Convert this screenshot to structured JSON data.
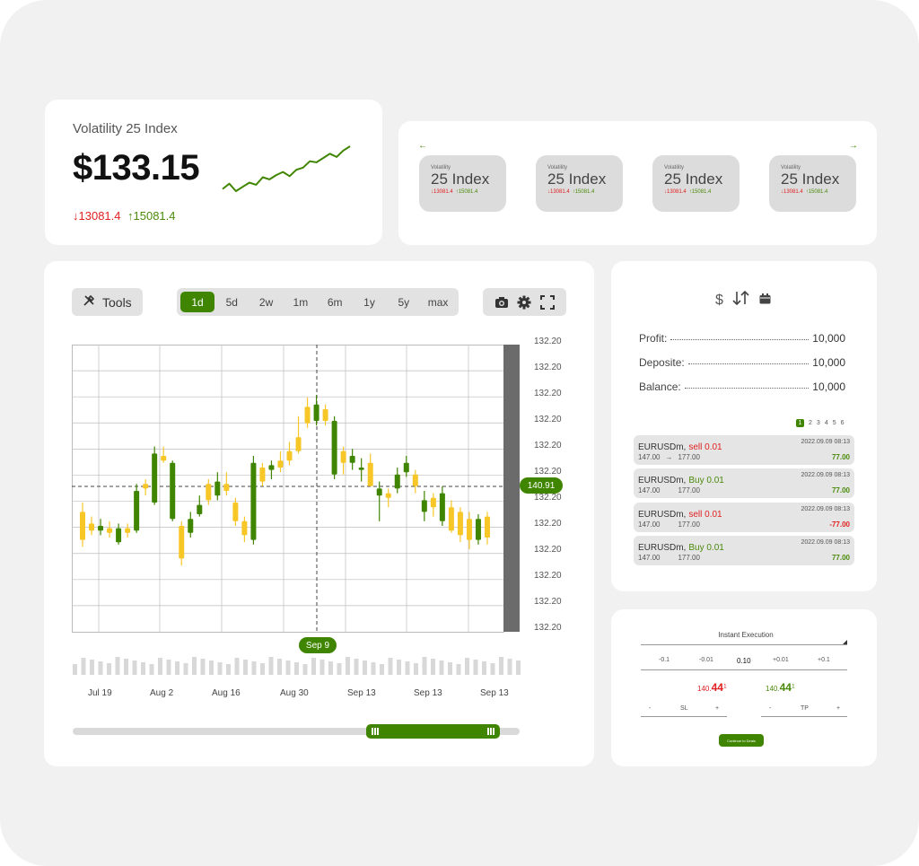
{
  "ticker": {
    "title": "Volatility 25 Index",
    "price": "$133.15",
    "change_down": "13081.4",
    "change_up": "15081.4",
    "sparkline": [
      3,
      3.5,
      2.8,
      3.2,
      3.6,
      3.4,
      4.1,
      3.9,
      4.3,
      4.6,
      4.2,
      4.8,
      5.0,
      5.6,
      5.5,
      5.9,
      6.3,
      6.0,
      6.6,
      7.0
    ]
  },
  "indices": {
    "prev_icon": "arrow-left-icon",
    "next_icon": "arrow-right-icon",
    "cards": [
      {
        "label": "Volatility",
        "name": "25 Index",
        "down": "13081.4",
        "up": "15081.4"
      },
      {
        "label": "Volatility",
        "name": "25 Index",
        "down": "13081.4",
        "up": "15081.4"
      },
      {
        "label": "Volatility",
        "name": "25 Index",
        "down": "13081.4",
        "up": "15081.4"
      },
      {
        "label": "Volatility",
        "name": "25 Index",
        "down": "13081.4",
        "up": "15081.4"
      }
    ]
  },
  "chart": {
    "tools_label": "Tools",
    "ranges": [
      "1d",
      "5d",
      "2w",
      "1m",
      "6m",
      "1y",
      "5y",
      "max"
    ],
    "active_range": "1d",
    "icons": [
      "camera-icon",
      "gear-icon",
      "fullscreen-icon"
    ],
    "current_price_tag": "140.91",
    "crosshair_date": "Sep 9",
    "colors": {
      "up": "#3f8500",
      "down": "#f7c627"
    }
  },
  "chart_data": {
    "type": "candlestick",
    "y_tick_labels": [
      "132.20",
      "132.20",
      "132.20",
      "132.20",
      "132.20",
      "132.20",
      "132.20",
      "132.20",
      "132.20",
      "132.20",
      "132.20",
      "132.20"
    ],
    "x_tick_labels": [
      "Jul 19",
      "Aug 2",
      "Aug 16",
      "Aug 30",
      "Sep 13",
      "Sep 13",
      "Sep 13"
    ],
    "candles": [
      {
        "dir": "down",
        "o": 4.6,
        "c": 3.4,
        "h": 5.0,
        "l": 3.1
      },
      {
        "dir": "down",
        "o": 4.1,
        "c": 3.8,
        "h": 4.4,
        "l": 3.6
      },
      {
        "dir": "up",
        "o": 3.8,
        "c": 4.0,
        "h": 4.3,
        "l": 3.6
      },
      {
        "dir": "down",
        "o": 3.9,
        "c": 3.7,
        "h": 4.2,
        "l": 3.5
      },
      {
        "dir": "up",
        "o": 3.3,
        "c": 3.9,
        "h": 4.1,
        "l": 3.2
      },
      {
        "dir": "down",
        "o": 3.9,
        "c": 3.7,
        "h": 4.1,
        "l": 3.5
      },
      {
        "dir": "up",
        "o": 3.8,
        "c": 5.5,
        "h": 5.8,
        "l": 3.7
      },
      {
        "dir": "down",
        "o": 5.8,
        "c": 5.6,
        "h": 6.0,
        "l": 5.3
      },
      {
        "dir": "up",
        "o": 5.0,
        "c": 7.1,
        "h": 7.4,
        "l": 4.9
      },
      {
        "dir": "down",
        "o": 7.0,
        "c": 6.8,
        "h": 7.4,
        "l": 6.7
      },
      {
        "dir": "up",
        "o": 4.3,
        "c": 6.7,
        "h": 6.8,
        "l": 4.2
      },
      {
        "dir": "down",
        "o": 4.0,
        "c": 2.6,
        "h": 4.2,
        "l": 2.3
      },
      {
        "dir": "up",
        "o": 3.7,
        "c": 4.3,
        "h": 4.6,
        "l": 3.5
      },
      {
        "dir": "up",
        "o": 4.5,
        "c": 4.9,
        "h": 5.3,
        "l": 4.4
      },
      {
        "dir": "down",
        "o": 5.8,
        "c": 5.1,
        "h": 6.0,
        "l": 4.9
      },
      {
        "dir": "up",
        "o": 5.3,
        "c": 5.9,
        "h": 6.3,
        "l": 5.1
      },
      {
        "dir": "down",
        "o": 5.8,
        "c": 5.5,
        "h": 6.3,
        "l": 5.3
      },
      {
        "dir": "down",
        "o": 5.0,
        "c": 4.2,
        "h": 5.2,
        "l": 4.0
      },
      {
        "dir": "down",
        "o": 4.2,
        "c": 3.6,
        "h": 4.4,
        "l": 3.3
      },
      {
        "dir": "up",
        "o": 3.4,
        "c": 6.7,
        "h": 7.0,
        "l": 3.2
      },
      {
        "dir": "down",
        "o": 6.5,
        "c": 5.9,
        "h": 6.7,
        "l": 5.7
      },
      {
        "dir": "up",
        "o": 6.4,
        "c": 6.6,
        "h": 6.8,
        "l": 6.0
      },
      {
        "dir": "down",
        "o": 6.8,
        "c": 6.5,
        "h": 7.2,
        "l": 6.3
      },
      {
        "dir": "down",
        "o": 7.2,
        "c": 6.8,
        "h": 7.6,
        "l": 6.6
      },
      {
        "dir": "down",
        "o": 7.8,
        "c": 7.2,
        "h": 8.7,
        "l": 7.1
      },
      {
        "dir": "down",
        "o": 9.1,
        "c": 8.4,
        "h": 9.5,
        "l": 8.2
      },
      {
        "dir": "up",
        "o": 8.5,
        "c": 9.2,
        "h": 9.6,
        "l": 8.3
      },
      {
        "dir": "down",
        "o": 9.0,
        "c": 8.5,
        "h": 9.2,
        "l": 8.3
      },
      {
        "dir": "up",
        "o": 6.2,
        "c": 8.5,
        "h": 8.7,
        "l": 6.0
      },
      {
        "dir": "down",
        "o": 7.2,
        "c": 6.7,
        "h": 7.4,
        "l": 6.2
      },
      {
        "dir": "up",
        "o": 6.7,
        "c": 7.0,
        "h": 7.3,
        "l": 6.4
      },
      {
        "dir": "up",
        "o": 6.4,
        "c": 6.5,
        "h": 6.9,
        "l": 5.9
      },
      {
        "dir": "down",
        "o": 6.7,
        "c": 5.7,
        "h": 7.1,
        "l": 5.7
      },
      {
        "dir": "up",
        "o": 5.3,
        "c": 5.6,
        "h": 5.9,
        "l": 4.2
      },
      {
        "dir": "down",
        "o": 5.4,
        "c": 5.2,
        "h": 5.6,
        "l": 4.8
      },
      {
        "dir": "up",
        "o": 5.6,
        "c": 6.2,
        "h": 6.5,
        "l": 5.4
      },
      {
        "dir": "up",
        "o": 6.3,
        "c": 6.7,
        "h": 7.0,
        "l": 6.1
      },
      {
        "dir": "down",
        "o": 6.2,
        "c": 5.7,
        "h": 6.4,
        "l": 5.4
      },
      {
        "dir": "up",
        "o": 4.6,
        "c": 5.1,
        "h": 5.5,
        "l": 4.2
      },
      {
        "dir": "down",
        "o": 5.2,
        "c": 4.8,
        "h": 5.4,
        "l": 4.4
      },
      {
        "dir": "up",
        "o": 4.2,
        "c": 5.4,
        "h": 5.7,
        "l": 4.0
      },
      {
        "dir": "down",
        "o": 4.8,
        "c": 3.8,
        "h": 5.1,
        "l": 3.7
      },
      {
        "dir": "down",
        "o": 4.6,
        "c": 3.6,
        "h": 4.8,
        "l": 3.3
      },
      {
        "dir": "down",
        "o": 4.3,
        "c": 3.4,
        "h": 4.6,
        "l": 3.0
      },
      {
        "dir": "up",
        "o": 3.4,
        "c": 4.3,
        "h": 4.5,
        "l": 3.2
      },
      {
        "dir": "down",
        "o": 4.4,
        "c": 3.5,
        "h": 4.6,
        "l": 3.2
      }
    ]
  },
  "account": {
    "icons": [
      "dollar-icon",
      "sort-arrows-icon",
      "calendar-icon"
    ],
    "rows": [
      {
        "key": "Profit:",
        "value": "10,000"
      },
      {
        "key": "Deposite:",
        "value": "10,000"
      },
      {
        "key": "Balance:",
        "value": "10,000"
      }
    ],
    "pages": [
      "1",
      "2",
      "3",
      "4",
      "5",
      "6"
    ],
    "trades": [
      {
        "symbol": "EURUSDm,",
        "side": "sell 0.01",
        "side_type": "sell",
        "date": "2022.09.09 08:13",
        "open": "147.00",
        "arrow": "→",
        "close": "177.00",
        "pl": "77.00",
        "pl_type": "pos"
      },
      {
        "symbol": "EURUSDm,",
        "side": "Buy 0.01",
        "side_type": "buy",
        "date": "2022.09.09 08:13",
        "open": "147.00",
        "arrow": "",
        "close": "177.00",
        "pl": "77.00",
        "pl_type": "pos"
      },
      {
        "symbol": "EURUSDm,",
        "side": "sell 0.01",
        "side_type": "sell",
        "date": "2022.09.09 08:13",
        "open": "147.00",
        "arrow": "",
        "close": "177.00",
        "pl": "-77.00",
        "pl_type": "neg"
      },
      {
        "symbol": "EURUSDm,",
        "side": "Buy 0.01",
        "side_type": "buy",
        "date": "2022.09.09 08:13",
        "open": "147.00",
        "arrow": "",
        "close": "177.00",
        "pl": "77.00",
        "pl_type": "pos"
      }
    ]
  },
  "execution": {
    "title": "Instant Execution",
    "steps": [
      "-0.1",
      "-0.01",
      "0.10",
      "+0.01",
      "+0.1"
    ],
    "sell_price_small": "140.",
    "sell_price_big": "44",
    "sell_price_sup": "1",
    "buy_price_small": "140.",
    "buy_price_big": "44",
    "buy_price_sup": "1",
    "sl": {
      "minus": "-",
      "label": "SL",
      "plus": "+"
    },
    "tp": {
      "minus": "-",
      "label": "TP",
      "plus": "+"
    },
    "button": "Continue to Deals"
  }
}
